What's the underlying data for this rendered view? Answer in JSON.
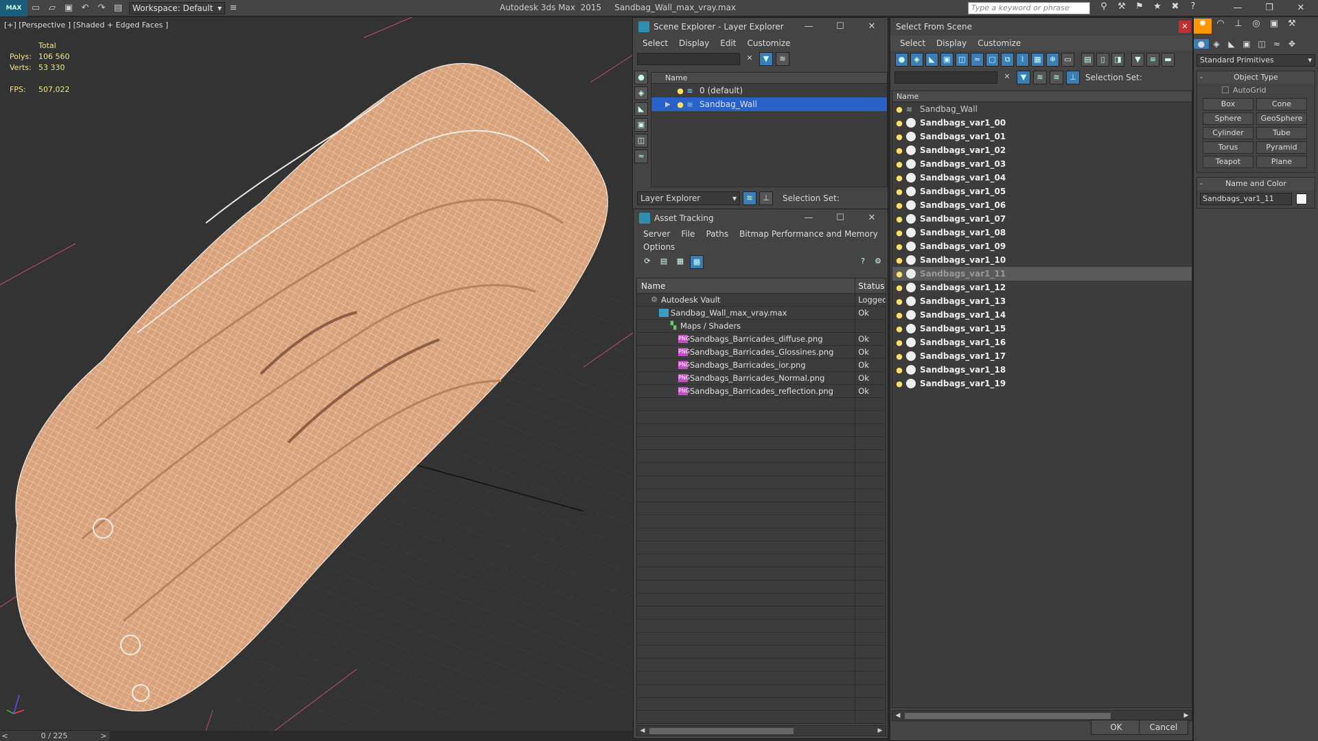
{
  "titlebar": {
    "logo": "MAX",
    "workspace": "Workspace: Default",
    "app_title": "Autodesk 3ds Max  2015     Sandbag_Wall_max_vray.max",
    "search_placeholder": "Type a keyword or phrase",
    "minimize": "—",
    "maximize": "❐",
    "close": "✕"
  },
  "viewport": {
    "label": "[+] [Perspective ] [Shaded + Edged Faces ]",
    "stats_total_label": "Total",
    "polys_label": "Polys:",
    "polys_value": "106 560",
    "verts_label": "Verts:",
    "verts_value": "53 330",
    "fps_label": "FPS:",
    "fps_value": "507,022",
    "mesh_color": "#d9a27a"
  },
  "timeslider": {
    "prev": "<",
    "value": "0 / 225",
    "next": ">"
  },
  "scene_explorer": {
    "title": "Scene Explorer - Layer Explorer",
    "menu": [
      "Select",
      "Display",
      "Edit",
      "Customize"
    ],
    "col_name": "Name",
    "layers": [
      {
        "name": "0 (default)",
        "selected": false
      },
      {
        "name": "Sandbag_Wall",
        "selected": true
      }
    ],
    "explorer_dropdown": "Layer Explorer",
    "selection_set_label": "Selection Set:"
  },
  "asset_tracking": {
    "title": "Asset Tracking",
    "menu": [
      "Server",
      "File",
      "Paths",
      "Bitmap Performance and Memory"
    ],
    "menu2": "Options",
    "col_name": "Name",
    "col_status": "Status",
    "rows": [
      {
        "name": "Autodesk Vault",
        "status": "Logged",
        "indent": 18,
        "icon": "vault"
      },
      {
        "name": "Sandbag_Wall_max_vray.max",
        "status": "Ok",
        "indent": 32,
        "icon": "max"
      },
      {
        "name": "Maps / Shaders",
        "status": "",
        "indent": 46,
        "icon": "maps"
      },
      {
        "name": "Sandbags_Barricades_diffuse.png",
        "status": "Ok",
        "indent": 60,
        "icon": "png"
      },
      {
        "name": "Sandbags_Barricades_Glossines.png",
        "status": "Ok",
        "indent": 60,
        "icon": "png"
      },
      {
        "name": "Sandbags_Barricades_ior.png",
        "status": "Ok",
        "indent": 60,
        "icon": "png"
      },
      {
        "name": "Sandbags_Barricades_Normal.png",
        "status": "Ok",
        "indent": 60,
        "icon": "png"
      },
      {
        "name": "Sandbags_Barricades_reflection.png",
        "status": "Ok",
        "indent": 60,
        "icon": "png"
      }
    ]
  },
  "select_from_scene": {
    "title": "Select From Scene",
    "menu": [
      "Select",
      "Display",
      "Customize"
    ],
    "selection_set_label": "Selection Set:",
    "col_name": "Name",
    "parent": "Sandbag_Wall",
    "objects": [
      "Sandbags_var1_00",
      "Sandbags_var1_01",
      "Sandbags_var1_02",
      "Sandbags_var1_03",
      "Sandbags_var1_04",
      "Sandbags_var1_05",
      "Sandbags_var1_06",
      "Sandbags_var1_07",
      "Sandbags_var1_08",
      "Sandbags_var1_09",
      "Sandbags_var1_10",
      "Sandbags_var1_11",
      "Sandbags_var1_12",
      "Sandbags_var1_13",
      "Sandbags_var1_14",
      "Sandbags_var1_15",
      "Sandbags_var1_16",
      "Sandbags_var1_17",
      "Sandbags_var1_18",
      "Sandbags_var1_19"
    ],
    "highlighted": "Sandbags_var1_11",
    "ok": "OK",
    "cancel": "Cancel"
  },
  "command_panel": {
    "category": "Standard Primitives",
    "object_type_title": "Object Type",
    "autogrid": "AutoGrid",
    "buttons": [
      "Box",
      "Cone",
      "Sphere",
      "GeoSphere",
      "Cylinder",
      "Tube",
      "Torus",
      "Pyramid",
      "Teapot",
      "Plane"
    ],
    "name_color_title": "Name and Color",
    "object_name": "Sandbags_var1_11"
  }
}
